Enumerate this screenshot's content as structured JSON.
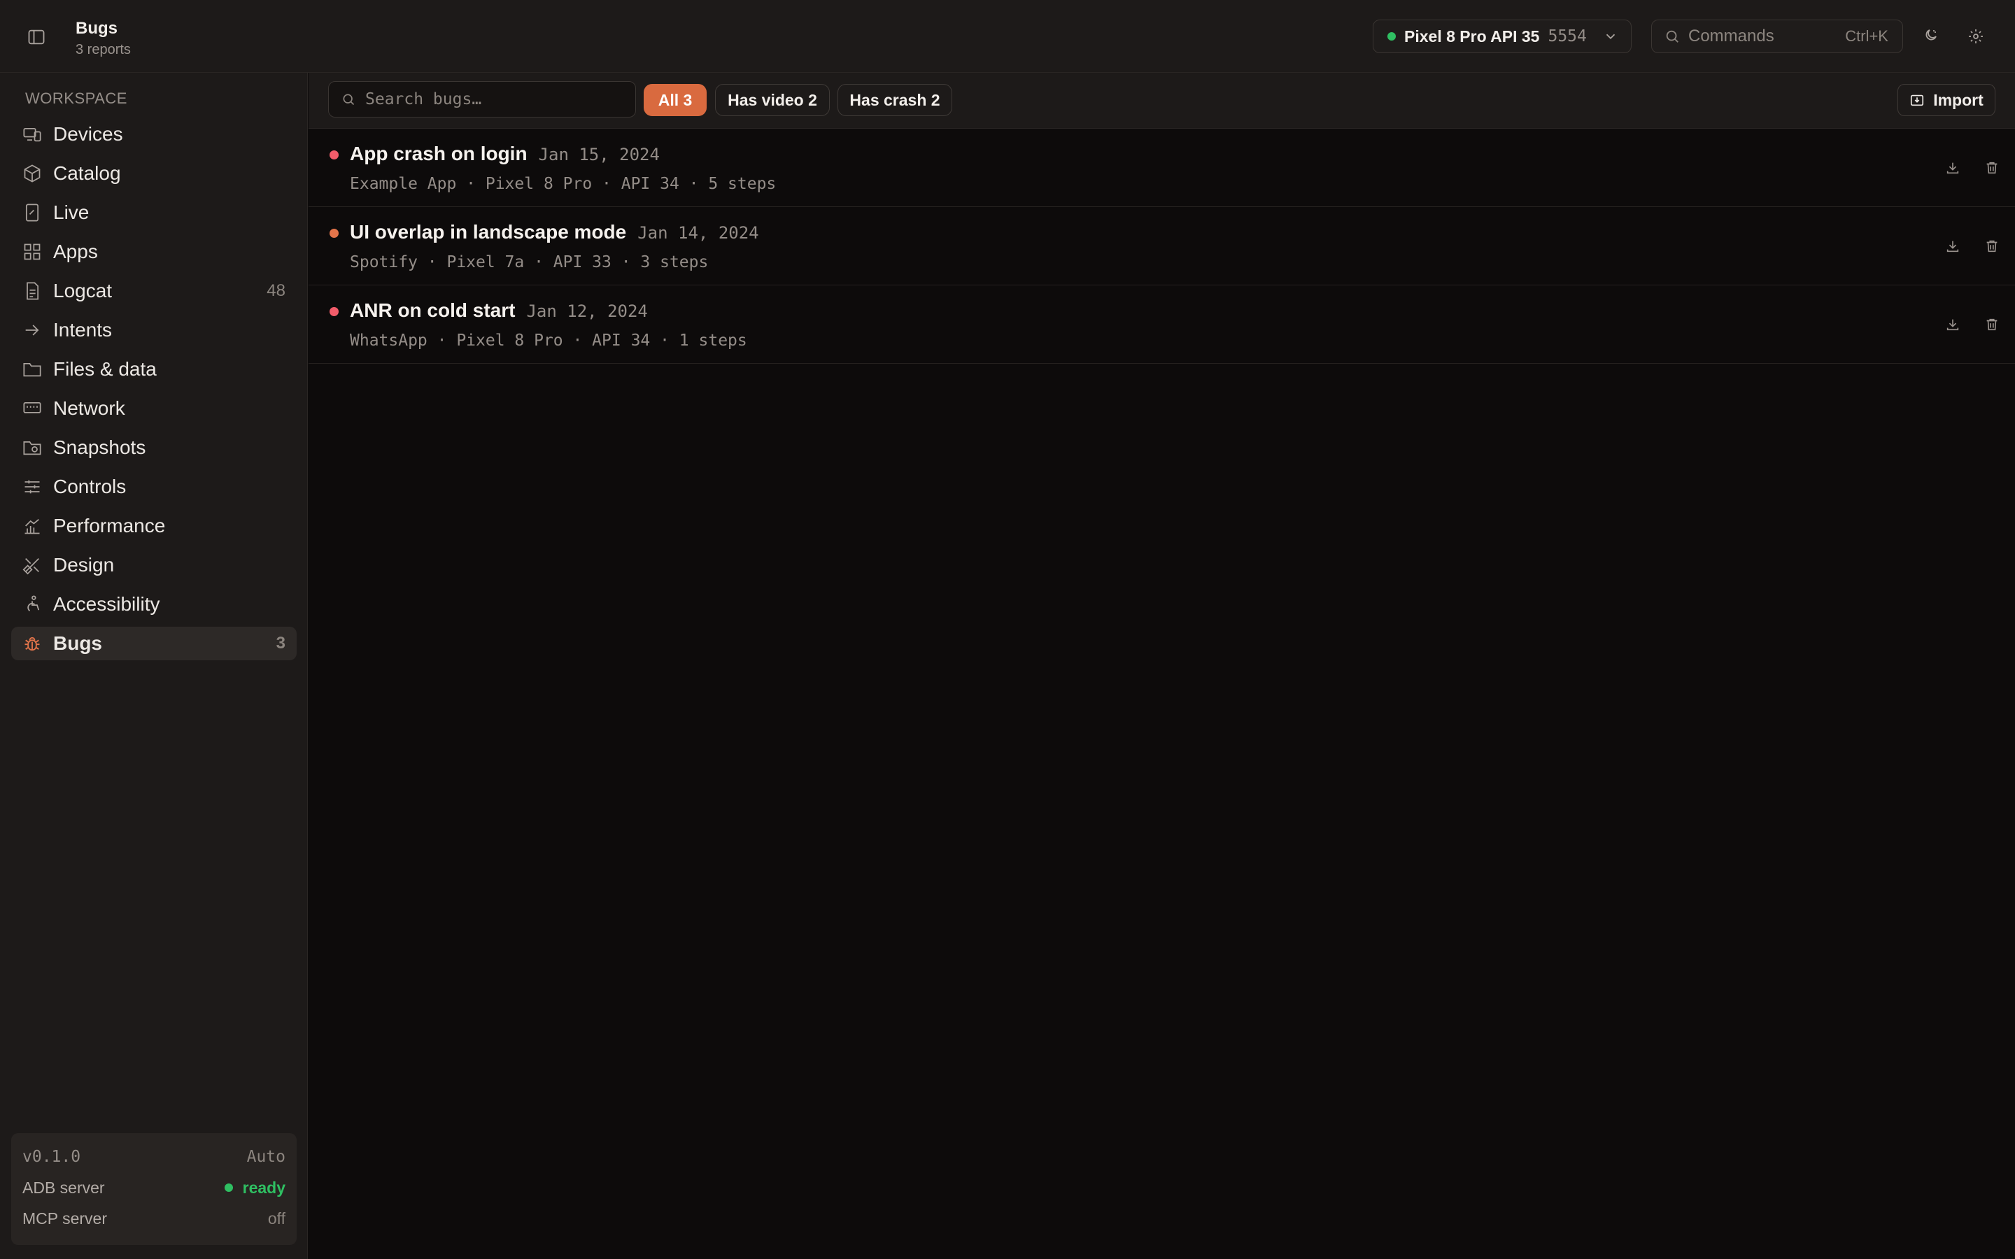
{
  "header": {
    "title": "Bugs",
    "subtitle": "3 reports",
    "device": {
      "name": "Pixel 8 Pro API 35",
      "port": "5554",
      "status_color": "#2fbf62"
    },
    "command_palette": {
      "placeholder": "Commands",
      "shortcut": "Ctrl+K"
    },
    "icons": [
      "sidebar-toggle-icon",
      "chevron-down-icon",
      "search-icon",
      "theme-toggle-icon",
      "gear-icon"
    ]
  },
  "sidebar": {
    "section_label": "WORKSPACE",
    "items": [
      {
        "label": "Devices",
        "icon": "devices-icon",
        "badge": ""
      },
      {
        "label": "Catalog",
        "icon": "box-icon",
        "badge": ""
      },
      {
        "label": "Live",
        "icon": "live-screen-icon",
        "badge": ""
      },
      {
        "label": "Apps",
        "icon": "apps-grid-icon",
        "badge": ""
      },
      {
        "label": "Logcat",
        "icon": "log-file-icon",
        "badge": "48"
      },
      {
        "label": "Intents",
        "icon": "arrow-right-icon",
        "badge": ""
      },
      {
        "label": "Files & data",
        "icon": "folder-icon",
        "badge": ""
      },
      {
        "label": "Network",
        "icon": "ethernet-icon",
        "badge": ""
      },
      {
        "label": "Snapshots",
        "icon": "folder-clock-icon",
        "badge": ""
      },
      {
        "label": "Controls",
        "icon": "sliders-icon",
        "badge": ""
      },
      {
        "label": "Performance",
        "icon": "chart-icon",
        "badge": ""
      },
      {
        "label": "Design",
        "icon": "design-tools-icon",
        "badge": ""
      },
      {
        "label": "Accessibility",
        "icon": "accessibility-icon",
        "badge": ""
      },
      {
        "label": "Bugs",
        "icon": "bug-icon",
        "badge": "3",
        "active": true
      }
    ],
    "status": {
      "version": "v0.1.0",
      "theme": "Auto",
      "adb_label": "ADB server",
      "adb_value": "ready",
      "mcp_label": "MCP server",
      "mcp_value": "off"
    }
  },
  "toolbar": {
    "search_placeholder": "Search bugs…",
    "filters": [
      {
        "label": "All 3",
        "active": true
      },
      {
        "label": "Has video 2",
        "active": false
      },
      {
        "label": "Has crash 2",
        "active": false
      }
    ],
    "import_label": "Import"
  },
  "bugs": [
    {
      "title": "App crash on login",
      "date": "Jan 15, 2024",
      "meta": "Example App · Pixel 8 Pro · API 34 · 5 steps",
      "dot_color": "#f25c6a"
    },
    {
      "title": "UI overlap in landscape mode",
      "date": "Jan 14, 2024",
      "meta": "Spotify · Pixel 7a · API 33 · 3 steps",
      "dot_color": "#e2744a"
    },
    {
      "title": "ANR on cold start",
      "date": "Jan 12, 2024",
      "meta": "WhatsApp · Pixel 8 Pro · API 34 · 1 steps",
      "dot_color": "#f25c6a"
    }
  ],
  "colors": {
    "accent": "#d96a3f",
    "ready": "#2fbf62",
    "crash": "#f25c6a",
    "warning": "#e2744a"
  }
}
